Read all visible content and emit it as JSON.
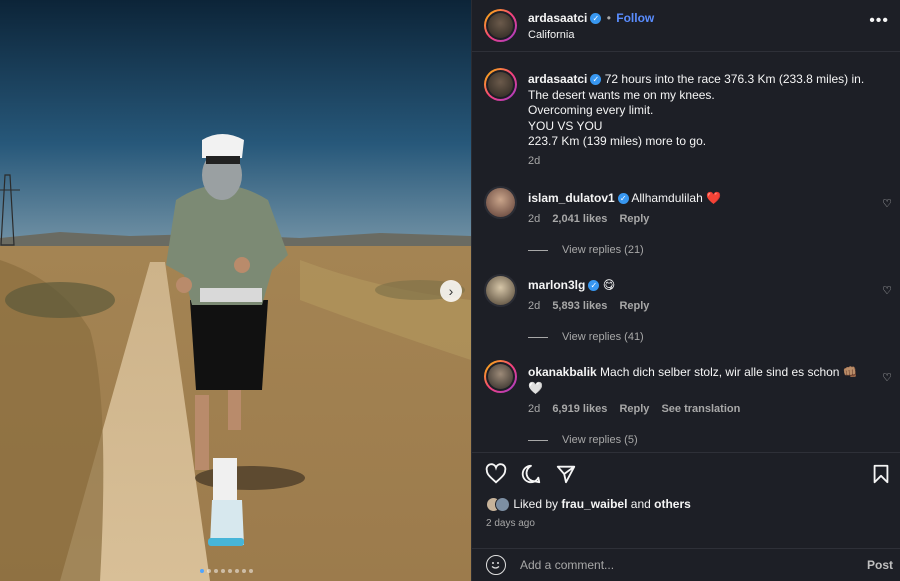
{
  "photo": {
    "next_icon": "chevron-right-icon",
    "carousel_count": 8,
    "carousel_active": 0
  },
  "header": {
    "username": "ardasaatci",
    "follow_label": "Follow",
    "location": "California",
    "more_icon": "more-horizontal-icon",
    "separator": "•"
  },
  "caption": {
    "username": "ardasaatci",
    "line1": "72 hours into the race 376.3 Km (233.8 miles) in.",
    "line2": "The desert wants me on my knees.",
    "line3": "Overcoming every limit.",
    "line4": "YOU VS YOU",
    "line5": "223.7 Km (139 miles) more to go.",
    "time": "2d"
  },
  "comments": [
    {
      "username": "islam_dulatov1",
      "text": "Allhamdulilah",
      "emoji": "❤️",
      "time": "2d",
      "likes": "2,041 likes",
      "reply": "Reply",
      "view_replies": "View replies (21)"
    },
    {
      "username": "marlon3lg",
      "text": "",
      "emoji": "😋",
      "time": "2d",
      "likes": "5,893 likes",
      "reply": "Reply",
      "view_replies": "View replies (41)"
    },
    {
      "username": "okanakbalik",
      "text": "Mach dich selber stolz, wir alle sind es schon",
      "emoji": "👊🏽",
      "emoji2": "🤍",
      "time": "2d",
      "likes": "6,919 likes",
      "reply": "Reply",
      "translate": "See translation",
      "view_replies": "View replies (5)"
    }
  ],
  "actions": {
    "like_icon": "heart-icon",
    "comment_icon": "comment-icon",
    "share_icon": "share-icon",
    "save_icon": "bookmark-icon"
  },
  "likes_summary": {
    "prefix": "Liked by",
    "user": "frau_waibel",
    "and": "and",
    "others": "others"
  },
  "post_time": "2 days ago",
  "comment_input": {
    "placeholder": "Add a comment...",
    "post_label": "Post",
    "emoji_icon": "smiley-icon"
  }
}
